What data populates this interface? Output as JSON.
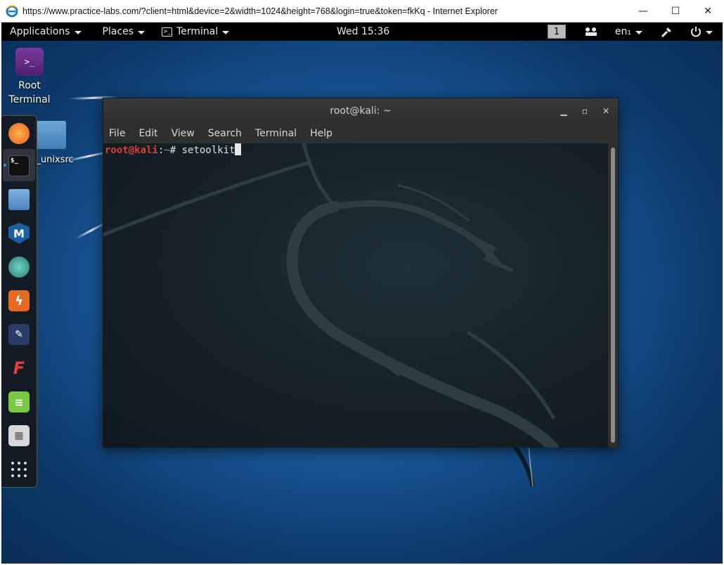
{
  "browser": {
    "title": "https://www.practice-labs.com/?client=html&device=2&width=1024&height=768&login=true&token=fkKq - Internet Explorer",
    "minimize": "—",
    "maximize": "☐",
    "close": "✕"
  },
  "panel": {
    "applications": "Applications",
    "places": "Places",
    "terminal": "Terminal",
    "clock": "Wed 15:36",
    "workspace": "1",
    "language": "en₁"
  },
  "desktop": {
    "root_terminal_label": "Root Terminal",
    "folder_label": "nc_unixsrc"
  },
  "terminal": {
    "title": "root@kali: ~",
    "menu": [
      "File",
      "Edit",
      "View",
      "Search",
      "Terminal",
      "Help"
    ],
    "prompt_user": "root@kali",
    "prompt_sep": ":",
    "prompt_path": "~",
    "prompt_symbol": "# ",
    "command": "setoolkit"
  },
  "icons": {
    "dock": [
      "firefox-icon",
      "terminal-icon",
      "files-icon",
      "metasploit-icon",
      "armitage-icon",
      "burpsuite-icon",
      "beef-icon",
      "faraday-icon",
      "text-editor-icon",
      "keyboard-icon",
      "show-apps-icon"
    ],
    "panel": [
      "terminal-icon",
      "network-icon",
      "settings-icon",
      "power-icon"
    ]
  },
  "colors": {
    "panel_bg": "#000000",
    "prompt_user": "#e03c3c",
    "prompt_path": "#4aa0e8"
  }
}
